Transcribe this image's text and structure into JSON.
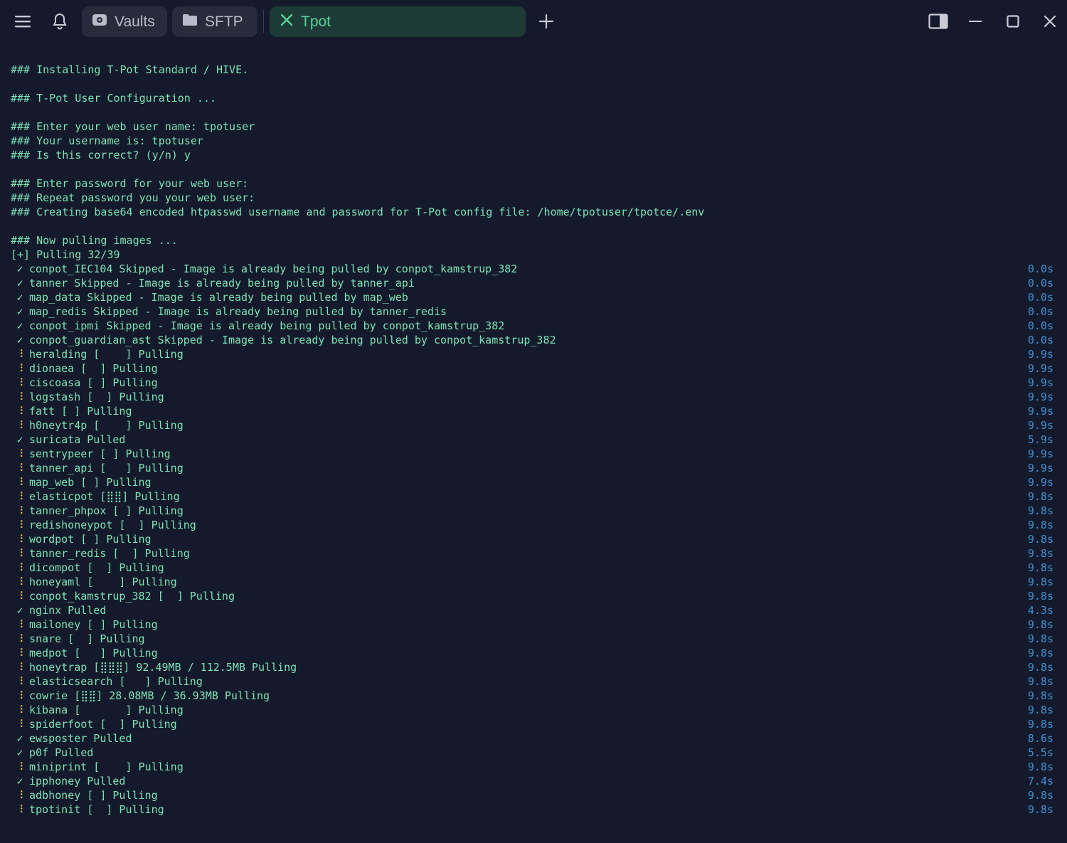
{
  "titlebar": {
    "menu_icon": "hamburger-menu-icon",
    "bell_icon": "bell-icon",
    "tabs": [
      {
        "label": "Vaults",
        "icon": "vault-icon"
      },
      {
        "label": "SFTP",
        "icon": "folder-icon"
      },
      {
        "label": "Tpot",
        "icon": "close-icon",
        "active": true
      }
    ],
    "new_tab_icon": "plus-icon",
    "window_controls": [
      "sidebar-toggle-icon",
      "minimize-icon",
      "maximize-icon",
      "close-icon"
    ]
  },
  "colors": {
    "background": "#141a2b",
    "text": "#7ee2b8",
    "spinner": "#e6b450",
    "timing": "#3f8fd1",
    "active_tab": "#1d3a36"
  },
  "terminal": {
    "lines": [
      "### Installing T-Pot Standard / HIVE.",
      "",
      "### T-Pot User Configuration ...",
      "",
      "### Enter your web user name: tpotuser",
      "### Your username is: tpotuser",
      "### Is this correct? (y/n) y",
      "",
      "### Enter password for your web user:",
      "### Repeat password you your web user:",
      "### Creating base64 encoded htpasswd username and password for T-Pot config file: /home/tpotuser/tpotce/.env",
      "",
      "### Now pulling images ...",
      "[+] Pulling 32/39"
    ],
    "pull_rows": [
      {
        "status": "done",
        "text": "conpot_IEC104 Skipped - Image is already being pulled by conpot_kamstrup_382",
        "time": "0.0s"
      },
      {
        "status": "done",
        "text": "tanner Skipped - Image is already being pulled by tanner_api",
        "time": "0.0s"
      },
      {
        "status": "done",
        "text": "map_data Skipped - Image is already being pulled by map_web",
        "time": "0.0s"
      },
      {
        "status": "done",
        "text": "map_redis Skipped - Image is already being pulled by tanner_redis",
        "time": "0.0s"
      },
      {
        "status": "done",
        "text": "conpot_ipmi Skipped - Image is already being pulled by conpot_kamstrup_382",
        "time": "0.0s"
      },
      {
        "status": "done",
        "text": "conpot_guardian_ast Skipped - Image is already being pulled by conpot_kamstrup_382",
        "time": "0.0s"
      },
      {
        "status": "spin",
        "text": "heralding [    ] Pulling",
        "time": "9.9s"
      },
      {
        "status": "spin",
        "text": "dionaea [  ] Pulling",
        "time": "9.9s"
      },
      {
        "status": "spin",
        "text": "ciscoasa [ ] Pulling",
        "time": "9.9s"
      },
      {
        "status": "spin",
        "text": "logstash [  ] Pulling",
        "time": "9.9s"
      },
      {
        "status": "spin",
        "text": "fatt [ ] Pulling",
        "time": "9.9s"
      },
      {
        "status": "spin",
        "text": "h0neytr4p [    ] Pulling",
        "time": "9.9s"
      },
      {
        "status": "done",
        "text": "suricata Pulled",
        "time": "5.9s"
      },
      {
        "status": "spin",
        "text": "sentrypeer [ ] Pulling",
        "time": "9.9s"
      },
      {
        "status": "spin",
        "text": "tanner_api [   ] Pulling",
        "time": "9.9s"
      },
      {
        "status": "spin",
        "text": "map_web [ ] Pulling",
        "time": "9.9s"
      },
      {
        "status": "spin",
        "text": "elasticpot [⣿⣿] Pulling",
        "time": "9.8s"
      },
      {
        "status": "spin",
        "text": "tanner_phpox [ ] Pulling",
        "time": "9.8s"
      },
      {
        "status": "spin",
        "text": "redishoneypot [  ] Pulling",
        "time": "9.8s"
      },
      {
        "status": "spin",
        "text": "wordpot [ ] Pulling",
        "time": "9.8s"
      },
      {
        "status": "spin",
        "text": "tanner_redis [  ] Pulling",
        "time": "9.8s"
      },
      {
        "status": "spin",
        "text": "dicompot [  ] Pulling",
        "time": "9.8s"
      },
      {
        "status": "spin",
        "text": "honeyaml [    ] Pulling",
        "time": "9.8s"
      },
      {
        "status": "spin",
        "text": "conpot_kamstrup_382 [  ] Pulling",
        "time": "9.8s"
      },
      {
        "status": "done",
        "text": "nginx Pulled",
        "time": "4.3s"
      },
      {
        "status": "spin",
        "text": "mailoney [ ] Pulling",
        "time": "9.8s"
      },
      {
        "status": "spin",
        "text": "snare [  ] Pulling",
        "time": "9.8s"
      },
      {
        "status": "spin",
        "text": "medpot [   ] Pulling",
        "time": "9.8s"
      },
      {
        "status": "spin",
        "text": "honeytrap [⣿⣿⣿] 92.49MB / 112.5MB Pulling",
        "time": "9.8s"
      },
      {
        "status": "spin",
        "text": "elasticsearch [   ] Pulling",
        "time": "9.8s"
      },
      {
        "status": "spin",
        "text": "cowrie [⣿⣿] 28.08MB / 36.93MB Pulling",
        "time": "9.8s"
      },
      {
        "status": "spin",
        "text": "kibana [       ] Pulling",
        "time": "9.8s"
      },
      {
        "status": "spin",
        "text": "spiderfoot [  ] Pulling",
        "time": "9.8s"
      },
      {
        "status": "done",
        "text": "ewsposter Pulled",
        "time": "8.6s"
      },
      {
        "status": "done",
        "text": "p0f Pulled",
        "time": "5.5s"
      },
      {
        "status": "spin",
        "text": "miniprint [    ] Pulling",
        "time": "9.8s"
      },
      {
        "status": "done",
        "text": "ipphoney Pulled",
        "time": "7.4s"
      },
      {
        "status": "spin",
        "text": "adbhoney [ ] Pulling",
        "time": "9.8s"
      },
      {
        "status": "spin",
        "text": "tpotinit [  ] Pulling",
        "time": "9.8s"
      }
    ],
    "status_glyphs": {
      "done": "✓",
      "spin": "⠸"
    }
  }
}
